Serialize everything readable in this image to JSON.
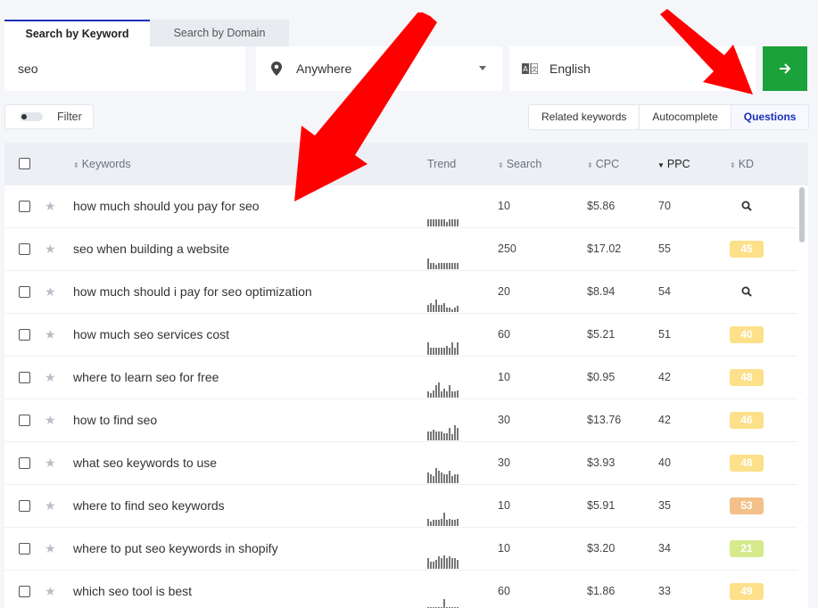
{
  "tabs": [
    {
      "label": "Search by Keyword"
    },
    {
      "label": "Search by Domain"
    }
  ],
  "search": {
    "keyword": "seo",
    "location": "Anywhere",
    "language": "English"
  },
  "filter": {
    "label": "Filter"
  },
  "modes": [
    {
      "label": "Related keywords"
    },
    {
      "label": "Autocomplete"
    },
    {
      "label": "Questions"
    }
  ],
  "table": {
    "headers": {
      "keywords": "Keywords",
      "trend": "Trend",
      "search": "Search",
      "cpc": "CPC",
      "ppc": "PPC",
      "kd": "KD"
    },
    "rows": [
      {
        "keyword": "how much should you pay for seo",
        "search": "10",
        "cpc": "$5.86",
        "ppc": "70",
        "kd": "",
        "trend": [
          5,
          5,
          5,
          5,
          5,
          5,
          5,
          3,
          5,
          5,
          5,
          5
        ]
      },
      {
        "keyword": "seo when building a website",
        "search": "250",
        "cpc": "$17.02",
        "ppc": "55",
        "kd": "45",
        "trend": [
          7,
          4,
          4,
          3,
          4,
          4,
          4,
          4,
          4,
          4,
          4,
          4
        ]
      },
      {
        "keyword": "how much should i pay for seo optimization",
        "search": "20",
        "cpc": "$8.94",
        "ppc": "54",
        "kd": "",
        "trend": [
          5,
          6,
          5,
          8,
          5,
          5,
          6,
          3,
          3,
          2,
          3,
          4
        ]
      },
      {
        "keyword": "how much seo services cost",
        "search": "60",
        "cpc": "$5.21",
        "ppc": "51",
        "kd": "40",
        "trend": [
          8,
          5,
          5,
          5,
          5,
          5,
          5,
          6,
          5,
          8,
          5,
          8
        ]
      },
      {
        "keyword": "where to learn seo for free",
        "search": "10",
        "cpc": "$0.95",
        "ppc": "42",
        "kd": "48",
        "trend": [
          4,
          3,
          5,
          8,
          10,
          4,
          6,
          4,
          8,
          4,
          4,
          5
        ]
      },
      {
        "keyword": "how to find seo",
        "search": "30",
        "cpc": "$13.76",
        "ppc": "42",
        "kd": "46",
        "trend": [
          6,
          6,
          7,
          6,
          6,
          6,
          5,
          5,
          8,
          4,
          10,
          8
        ]
      },
      {
        "keyword": "what seo keywords to use",
        "search": "30",
        "cpc": "$3.93",
        "ppc": "40",
        "kd": "48",
        "trend": [
          7,
          6,
          5,
          10,
          8,
          7,
          6,
          6,
          8,
          5,
          6,
          6
        ]
      },
      {
        "keyword": "where to find seo keywords",
        "search": "10",
        "cpc": "$5.91",
        "ppc": "35",
        "kd": "53",
        "trend": [
          5,
          3,
          4,
          4,
          4,
          5,
          9,
          4,
          5,
          4,
          4,
          5
        ]
      },
      {
        "keyword": "where to put seo keywords in shopify",
        "search": "10",
        "cpc": "$3.20",
        "ppc": "34",
        "kd": "21",
        "trend": [
          7,
          5,
          5,
          6,
          8,
          7,
          9,
          7,
          8,
          7,
          7,
          6
        ]
      },
      {
        "keyword": "which seo tool is best",
        "search": "60",
        "cpc": "$1.86",
        "ppc": "33",
        "kd": "49",
        "trend": [
          3,
          3,
          3,
          3,
          3,
          3,
          8,
          3,
          3,
          3,
          3,
          3
        ]
      }
    ]
  },
  "colors": {
    "kd_40": "#fde08a",
    "kd_45": "#fde08a",
    "kd_46": "#fde08a",
    "kd_48": "#fde08a",
    "kd_49": "#fde08a",
    "kd_53": "#f4c08a",
    "kd_21": "#d6ea8c",
    "accent_blue": "#1a2fb5",
    "go_green": "#1ca23a",
    "annotation_red": "#ff0000"
  }
}
